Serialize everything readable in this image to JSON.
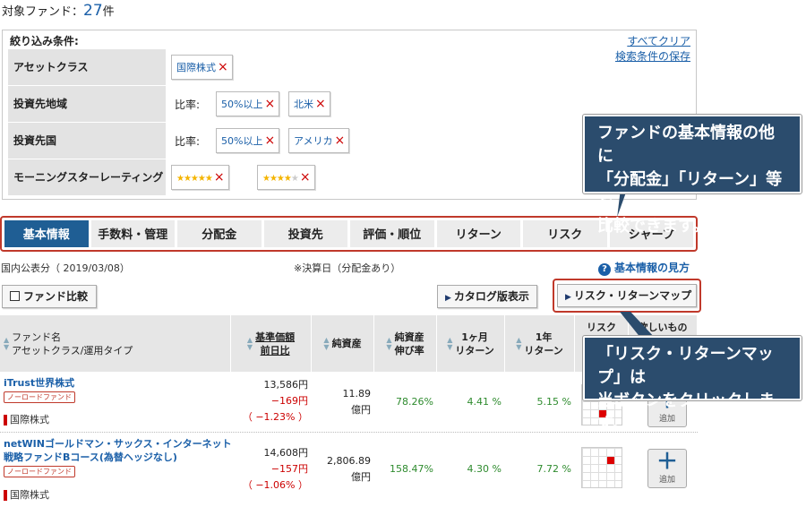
{
  "header": {
    "count_label": "対象ファンド：",
    "count_value": "27",
    "count_unit": "件"
  },
  "filter": {
    "title": "絞り込み条件:",
    "clear_all": "すべてクリア",
    "save": "検索条件の保存",
    "rows": [
      {
        "label": "アセットクラス",
        "prefix": "",
        "chips": [
          "国際株式"
        ]
      },
      {
        "label": "投資先地域",
        "prefix": "比率:",
        "chips": [
          "50%以上",
          "北米"
        ]
      },
      {
        "label": "投資先国",
        "prefix": "比率:",
        "chips": [
          "50%以上",
          "アメリカ"
        ]
      },
      {
        "label": "モーニングスターレーティング",
        "prefix": "",
        "ratings": [
          5,
          4
        ]
      }
    ],
    "remove_icon": "×"
  },
  "tabs": [
    "基本情報",
    "手数料・管理",
    "分配金",
    "投資先",
    "評価・順位",
    "リターン",
    "リスク",
    "シャープ"
  ],
  "info": {
    "pubdate": "国内公表分（ 2019/03/08）",
    "note": "※決算日（分配金あり）",
    "help": "基本情報の見方"
  },
  "buttons": {
    "compare": "ファンド比較",
    "catalog": "カタログ版表示",
    "map": "リスク・リターンマップ"
  },
  "table": {
    "headers": {
      "name1": "ファンド名",
      "name2": "アセットクラス/運用タイプ",
      "price1": "基準価額",
      "price2": "前日比",
      "assets": "純資産",
      "growth1": "純資産",
      "growth2": "伸び率",
      "ret1m1": "1ヶ月",
      "ret1m2": "リターン",
      "ret1y1": "1年",
      "ret1y2": "リターン",
      "risk": "リスク",
      "fav": "欲しいもの"
    },
    "rows": [
      {
        "name": "iTrust世界株式",
        "badge": "ノーロードファンド",
        "asset": "国際株式",
        "price": "13,586円",
        "change": "−169円",
        "pct": "（ −1.23% ）",
        "assets1": "11.89",
        "assets2": "億円",
        "growth": "78.26%",
        "r1m": "4.41 %",
        "r1y": "5.15 %",
        "add": "追加"
      },
      {
        "name": "netWINゴールドマン・サックス・インターネット戦略ファンドBコース(為替ヘッジなし)",
        "badge": "ノーロードファンド",
        "asset": "国際株式",
        "price": "14,608円",
        "change": "−157円",
        "pct": "（ −1.06% ）",
        "assets1": "2,806.89",
        "assets2": "億円",
        "growth": "158.47%",
        "r1m": "4.30 %",
        "r1y": "7.72 %",
        "add": "追加"
      }
    ]
  },
  "callouts": {
    "c1": [
      "ファンドの基本情報の他に",
      "「分配金」「リターン」等を",
      "比較できます。"
    ],
    "c2": [
      "「リスク・リターンマップ」は",
      "当ボタンをクリックします。"
    ]
  },
  "colors": {
    "active_tab": "#1f5e94",
    "highlight": "#c0392b",
    "callout": "#2b4c6d",
    "link": "#1a5fa8"
  }
}
